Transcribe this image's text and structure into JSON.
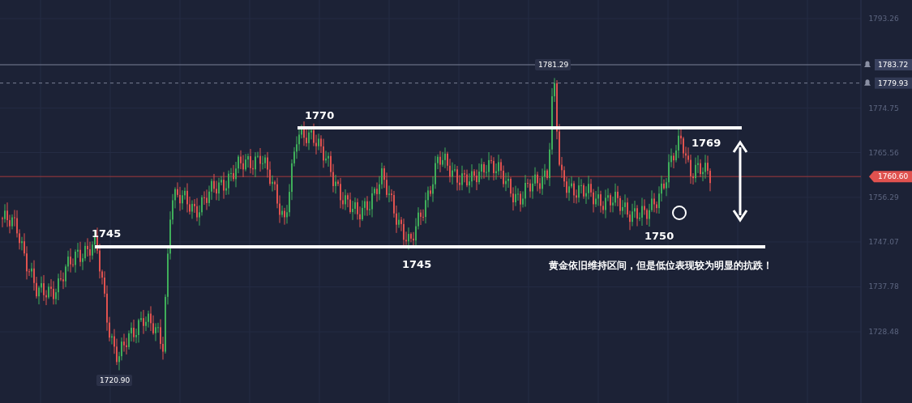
{
  "price_axis": {
    "labels": [
      "1793.26",
      "1774.75",
      "1765.56",
      "1756.29",
      "1747.07",
      "1737.78",
      "1728.48"
    ]
  },
  "alerts": [
    {
      "price": "1783.72",
      "kind": "solid"
    },
    {
      "price": "1779.93",
      "kind": "dashed"
    }
  ],
  "current_price": "1760.60",
  "high_marker": "1781.29",
  "low_marker": "1720.90",
  "annotations": [
    {
      "text": "1770"
    },
    {
      "text": "1769"
    },
    {
      "text": "1745"
    },
    {
      "text": "1745"
    },
    {
      "text": "1750"
    }
  ],
  "caption": "黄金依旧维持区间，但是低位表现较为明显的抗跌！"
}
